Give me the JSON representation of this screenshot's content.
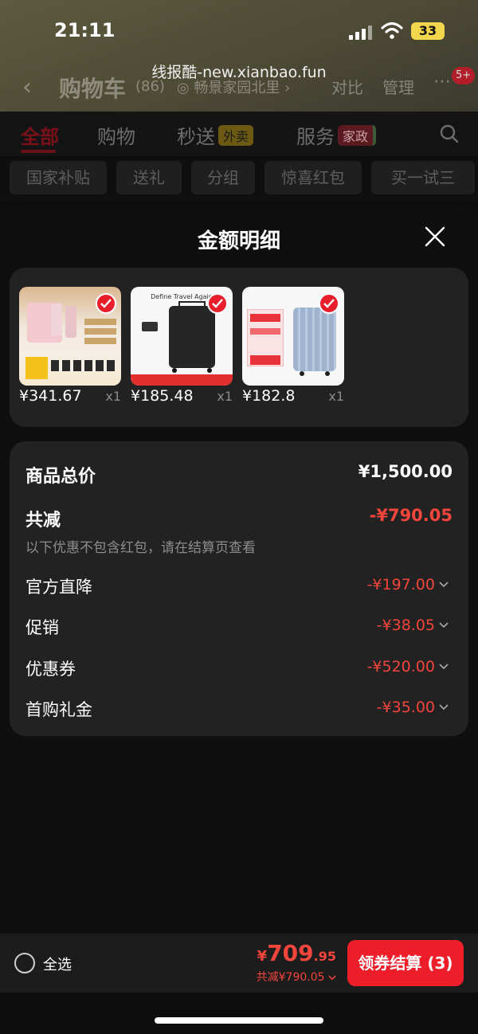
{
  "status_bar": {
    "time": "21:11",
    "battery": "33"
  },
  "watermark": "线报酷-new.xianbao.fun",
  "cart_header": {
    "title": "购物车",
    "count": "(86)",
    "location": "◎ 畅景家园北里 ›",
    "compare": "对比",
    "manage": "管理",
    "more": "⋯",
    "message_badge": "5+"
  },
  "tabs": [
    {
      "label": "全部",
      "active": true
    },
    {
      "label": "购物"
    },
    {
      "label": "秒送",
      "tag": "外卖"
    },
    {
      "label": "服务",
      "tag": "家政"
    }
  ],
  "filters": [
    "国家补贴",
    "送礼",
    "分组",
    "惊喜红包",
    "买一试三"
  ],
  "sheet": {
    "title": "金额明细"
  },
  "products": [
    {
      "price": "¥341.67",
      "qty": "x1",
      "image": "beauty-gift-set"
    },
    {
      "price": "¥185.48",
      "qty": "x1",
      "image": "black-suitcase",
      "image_caption": "Define Travel Again"
    },
    {
      "price": "¥182.8",
      "qty": "x1",
      "image": "blue-suitcase"
    }
  ],
  "summary": {
    "total_label": "商品总价",
    "total_value": "¥1,500.00",
    "reduce_label": "共减",
    "reduce_value": "-¥790.05",
    "note": "以下优惠不包含红包，请在结算页查看",
    "discounts": [
      {
        "label": "官方直降",
        "value": "-¥197.00"
      },
      {
        "label": "促销",
        "value": "-¥38.05"
      },
      {
        "label": "优惠券",
        "value": "-¥520.00"
      },
      {
        "label": "首购礼金",
        "value": "-¥35.00"
      }
    ]
  },
  "checkout": {
    "select_all": "全选",
    "currency": "¥",
    "price_int": "709",
    "price_dec": ".95",
    "savings": "共减¥790.05",
    "button": "领券结算 (3)"
  },
  "colors": {
    "accent": "#ee1d2a",
    "discount_red": "#f2453c",
    "card": "#222222",
    "background": "#0f0f0f"
  }
}
